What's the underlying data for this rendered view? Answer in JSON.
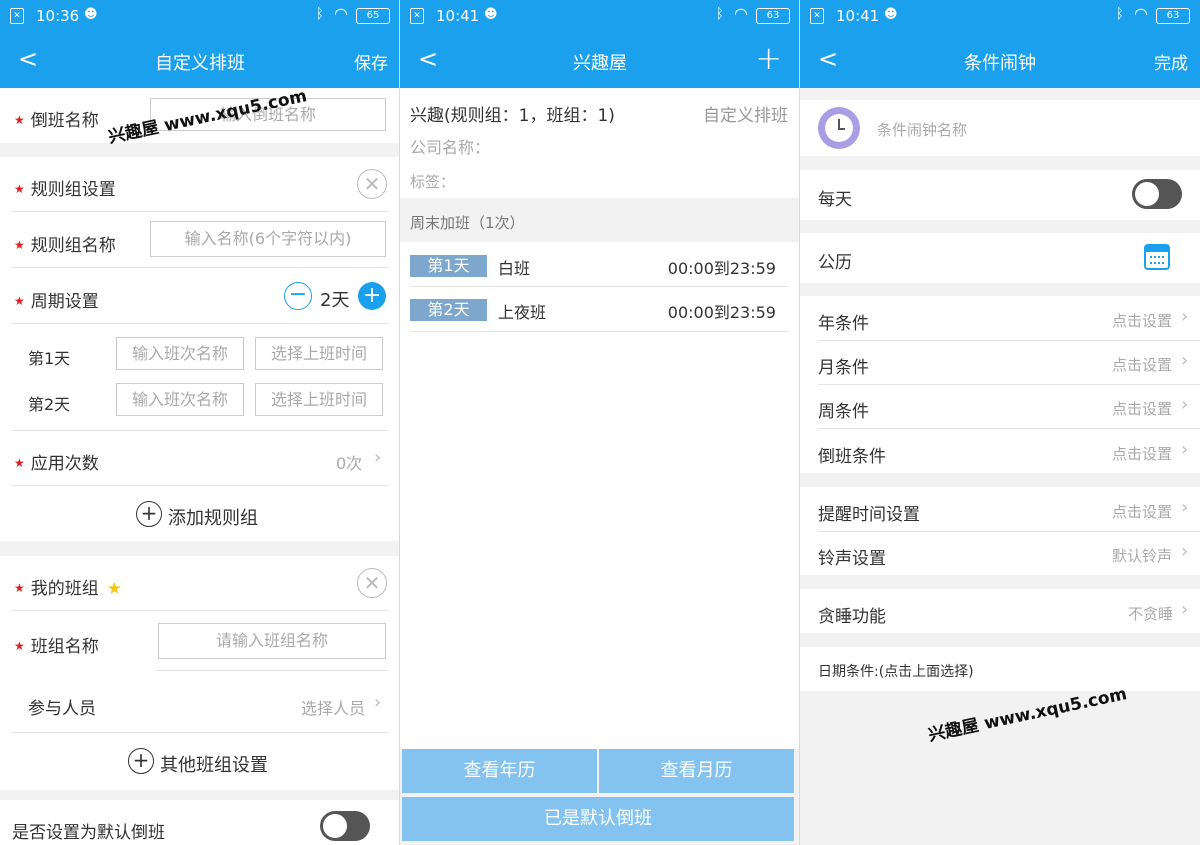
{
  "phone1": {
    "status": {
      "time": "10:36",
      "battery": "65"
    },
    "nav": {
      "back": "<",
      "title": "自定义排班",
      "action": "保存"
    },
    "shift_name_label": "倒班名称",
    "shift_name_placeholder": "输入倒班名称",
    "rule_group_settings": "规则组设置",
    "rule_group_name_label": "规则组名称",
    "rule_group_name_placeholder": "输入名称(6个字符以内)",
    "cycle_label": "周期设置",
    "cycle_value": "2天",
    "days": [
      {
        "label": "第1天",
        "shift_placeholder": "输入班次名称",
        "time_placeholder": "选择上班时间"
      },
      {
        "label": "第2天",
        "shift_placeholder": "输入班次名称",
        "time_placeholder": "选择上班时间"
      }
    ],
    "apply_count_label": "应用次数",
    "apply_count_value": "0次",
    "add_rule_group": "添加规则组",
    "my_group_label": "我的班组",
    "group_name_label": "班组名称",
    "group_name_placeholder": "请输入班组名称",
    "members_label": "参与人员",
    "members_value": "选择人员",
    "other_group_settings": "其他班组设置",
    "default_shift_label": "是否设置为默认倒班",
    "watermark": "兴趣屋 www.xqu5.com"
  },
  "phone2": {
    "status": {
      "time": "10:41",
      "battery": "63"
    },
    "nav": {
      "back": "<",
      "title": "兴趣屋",
      "action": "+"
    },
    "summary": "兴趣(规则组：1，班组：1)",
    "custom_tag": "自定义排班",
    "company_label": "公司名称：",
    "tags_label": "标签：",
    "section_title": "周末加班（1次）",
    "shifts": [
      {
        "day": "第1天",
        "name": "白班",
        "time": "00:00到23:59"
      },
      {
        "day": "第2天",
        "name": "上夜班",
        "time": "00:00到23:59"
      }
    ],
    "view_year": "查看年历",
    "view_month": "查看月历",
    "default_status": "已是默认倒班"
  },
  "phone3": {
    "status": {
      "time": "10:41",
      "battery": "63"
    },
    "nav": {
      "back": "<",
      "title": "条件闹钟",
      "action": "完成"
    },
    "alarm_name_placeholder": "条件闹钟名称",
    "every_day": "每天",
    "calendar": "公历",
    "conditions": [
      {
        "label": "年条件",
        "value": "点击设置"
      },
      {
        "label": "月条件",
        "value": "点击设置"
      },
      {
        "label": "周条件",
        "value": "点击设置"
      },
      {
        "label": "倒班条件",
        "value": "点击设置"
      }
    ],
    "reminder_time": {
      "label": "提醒时间设置",
      "value": "点击设置"
    },
    "ringtone": {
      "label": "铃声设置",
      "value": "默认铃声"
    },
    "snooze": {
      "label": "贪睡功能",
      "value": "不贪睡"
    },
    "date_condition": "日期条件:(点击上面选择)",
    "watermark": "兴趣屋 www.xqu5.com"
  },
  "colors": {
    "primary": "#1aa0ec",
    "button": "#84c2f0",
    "tag": "#7da7cc",
    "required": "#e02020"
  }
}
